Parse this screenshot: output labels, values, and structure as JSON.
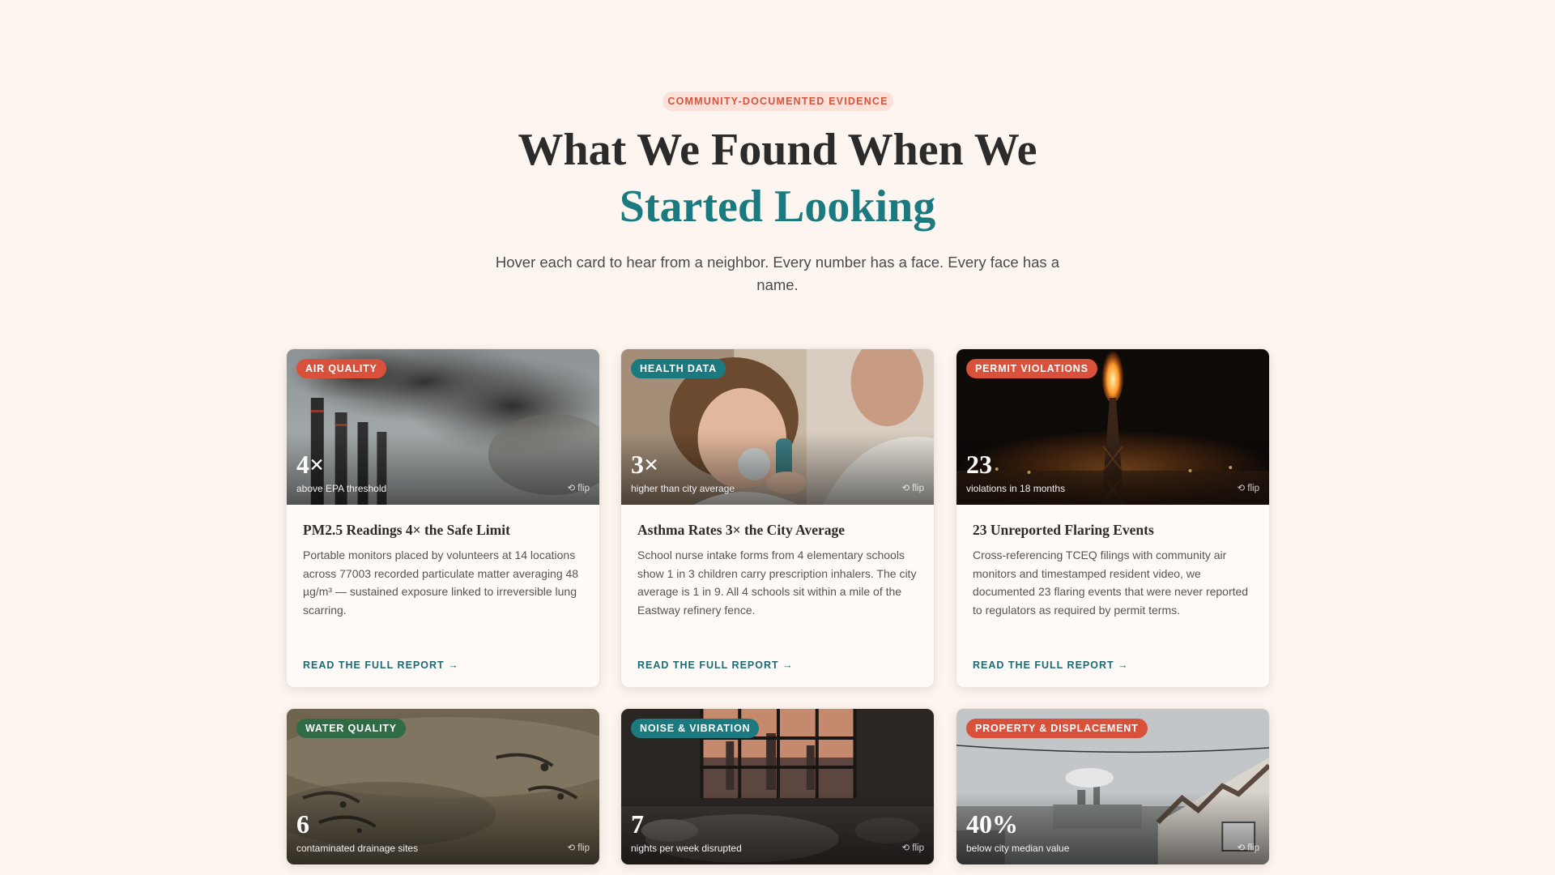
{
  "header": {
    "eyebrow": "COMMUNITY-DOCUMENTED EVIDENCE",
    "title_line1": "What We Found When We",
    "title_line2": "Started Looking",
    "subtitle": "Hover each card to hear from a neighbor. Every number has a face. Every face has a name."
  },
  "colors": {
    "background": "#fdf6f0",
    "accent_teal": "#1b7a80",
    "accent_coral": "#d9513a",
    "badge_green": "#2f6b45"
  },
  "cards": [
    {
      "badge": "AIR QUALITY",
      "stat": "4×",
      "stat_label": "above EPA threshold",
      "flip": "flip",
      "title": "PM2.5 Readings 4× the Safe Limit",
      "text": "Portable monitors placed by volunteers at 14 locations across 77003 recorded particulate matter averaging 48 µg/m³ — sustained exposure linked to irreversible lung scarring.",
      "cta": "READ THE FULL REPORT →"
    },
    {
      "badge": "HEALTH DATA",
      "stat": "3×",
      "stat_label": "higher than city average",
      "flip": "flip",
      "title": "Asthma Rates 3× the City Average",
      "text": "School nurse intake forms from 4 elementary schools show 1 in 3 children carry prescription inhalers. The city average is 1 in 9. All 4 schools sit within a mile of the Eastway refinery fence.",
      "cta": "READ THE FULL REPORT →"
    },
    {
      "badge": "PERMIT VIOLATIONS",
      "stat": "23",
      "stat_label": "violations in 18 months",
      "flip": "flip",
      "title": "23 Unreported Flaring Events",
      "text": "Cross-referencing TCEQ filings with community air monitors and timestamped resident video, we documented 23 flaring events that were never reported to regulators as required by permit terms.",
      "cta": "READ THE FULL REPORT →"
    },
    {
      "badge": "WATER QUALITY",
      "stat": "6",
      "stat_label": "contaminated drainage sites",
      "flip": "flip"
    },
    {
      "badge": "NOISE & VIBRATION",
      "stat": "7",
      "stat_label": "nights per week disrupted",
      "flip": "flip"
    },
    {
      "badge": "PROPERTY & DISPLACEMENT",
      "stat": "40%",
      "stat_label": "below city median value",
      "flip": "flip"
    }
  ]
}
